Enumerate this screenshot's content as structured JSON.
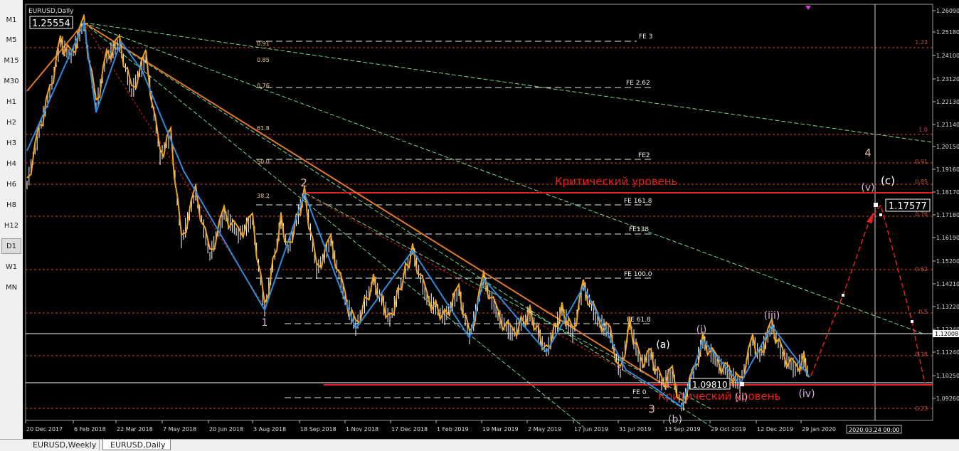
{
  "timeframes": [
    {
      "label": "M1",
      "active": false
    },
    {
      "label": "M5",
      "active": false
    },
    {
      "label": "M15",
      "active": false
    },
    {
      "label": "M30",
      "active": false
    },
    {
      "label": "H1",
      "active": false
    },
    {
      "label": "H2",
      "active": false
    },
    {
      "label": "H3",
      "active": false
    },
    {
      "label": "H4",
      "active": false
    },
    {
      "label": "H6",
      "active": false
    },
    {
      "label": "H8",
      "active": false
    },
    {
      "label": "H12",
      "active": false
    },
    {
      "label": "D1",
      "active": true
    },
    {
      "label": "W1",
      "active": false
    },
    {
      "label": "MN",
      "active": false
    }
  ],
  "chart": {
    "symbol_title": "EURUSD,Daily",
    "high_box": "1.25554",
    "price_box": "1.17577",
    "low_box": "1.09810",
    "current_price": "1.12008",
    "cursor_date": "2020.03.24 00:00",
    "critical_label": "Критический уровень",
    "price_axis": [
      "1.26090",
      "1.25180",
      "1.24100",
      "1.23120",
      "1.22130",
      "1.21140",
      "1.20150",
      "1.19160",
      "1.18170",
      "1.17180",
      "1.16190",
      "1.15200",
      "1.14210",
      "1.13220",
      "1.12240",
      "1.11240",
      "1.10250",
      "1.09260"
    ],
    "date_axis": [
      "20 Dec 2017",
      "6 Feb 2018",
      "22 Mar 2018",
      "7 May 2018",
      "20 Jun 2018",
      "3 Aug 2018",
      "18 Sep 2018",
      "1 Nov 2018",
      "17 Dec 2018",
      "1 Feb 2019",
      "19 Mar 2019",
      "2 May 2019",
      "17 Jun 2019",
      "31 Jul 2019",
      "13 Sep 2019",
      "29 Oct 2019",
      "12 Dec 2019",
      "29 Jan 2020"
    ],
    "fib_left": [
      "0.91",
      "0.85",
      "0.76",
      "61.8",
      "50.0",
      "38.2"
    ],
    "fe_labels": [
      "FE 3",
      "FE 2.62",
      "FE2",
      "FE 161.8",
      "FE138",
      "FE 100.0",
      "FE 61.8",
      "FE 0"
    ],
    "fib_right": [
      "1.23",
      "1.0",
      "0.91",
      "0.85",
      "0.76",
      "0.62",
      "0.5",
      "0.38",
      "0.23"
    ],
    "wave_labels": [
      "1",
      "2",
      "3",
      "4",
      "(a)",
      "(b)",
      "(c)",
      "(i)",
      "(ii)",
      "(iii)",
      "(iv)",
      "(v)"
    ]
  },
  "tabs": [
    {
      "label": "EURUSD,Weekly",
      "active": false
    },
    {
      "label": "EURUSD,Daily",
      "active": true
    }
  ],
  "colors": {
    "background": "#000000",
    "candles": "#ffffff",
    "zigzag_orange": "#f0a21c",
    "zigzag_blue": "#2e8bdd",
    "trend_orange": "#e0782a",
    "critical": "#e8201c",
    "fib_dotted": "#c0503e",
    "green_fan": "#7ad98a"
  }
}
